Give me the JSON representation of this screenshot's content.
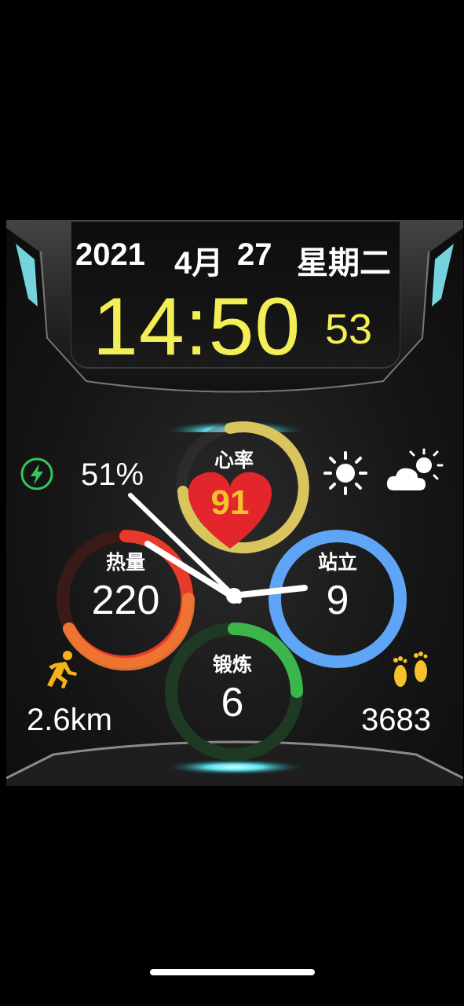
{
  "date": {
    "year": "2021",
    "month": "4月",
    "day": "27",
    "weekday": "星期二"
  },
  "time": {
    "hm": "14:50",
    "seconds": "53"
  },
  "battery": {
    "percent_text": "51%"
  },
  "heart_rate": {
    "label": "心率",
    "value": "91"
  },
  "calories": {
    "label": "热量",
    "value": "220"
  },
  "stand": {
    "label": "站立",
    "value": "9"
  },
  "exercise": {
    "label": "锻炼",
    "value": "6"
  },
  "distance": {
    "value": "2.6km"
  },
  "steps": {
    "value": "3683"
  },
  "icons": {
    "charge": "lightning-icon",
    "weather_now": "sun-icon",
    "weather_next": "cloud-sun-icon",
    "distance": "runner-icon",
    "steps": "footprints-icon"
  },
  "colors": {
    "time": "#f3ee55",
    "heart": "#e3262c",
    "heart_value": "#f6c22b",
    "calories_ring": "#e83a2a",
    "stand_ring": "#4f97f0",
    "exercise_ring": "#3cb64a",
    "heart_ring": "#d9c55e",
    "charge": "#34c759"
  }
}
